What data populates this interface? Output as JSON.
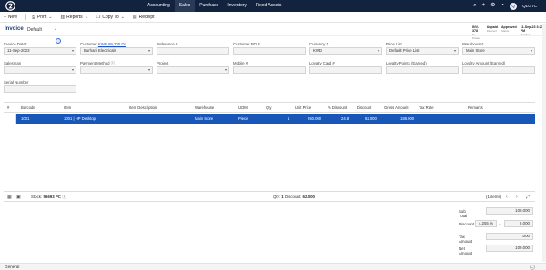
{
  "topbar": {
    "nav": [
      {
        "label": "Accounting",
        "active": false
      },
      {
        "label": "Sales",
        "active": true
      },
      {
        "label": "Purchase",
        "active": false
      },
      {
        "label": "Inventory",
        "active": false
      },
      {
        "label": "Fixed Assets",
        "active": false
      }
    ],
    "avatar_letter": "Q",
    "company": "QLGTC"
  },
  "toolbar": {
    "new_label": "New",
    "print_label": "Print",
    "reports_label": "Reports",
    "copy_to_label": "Copy To",
    "receipt_label": "Receipt"
  },
  "header": {
    "title": "Invoice",
    "layout": "Default"
  },
  "status_steps": [
    {
      "title": "INV-378",
      "sub": "No Posted"
    },
    {
      "title": "Unpaid",
      "sub": "Payment"
    },
    {
      "title": "Approved",
      "sub": "Status"
    },
    {
      "title": "11-Sep-23 3:27 PM",
      "sub": "Modified"
    }
  ],
  "fields": {
    "invoice_date": {
      "label": "Invoice Date*",
      "value": "11-Sep-2023"
    },
    "customer": {
      "label": "Customer",
      "link": "KWD 99,200 Dr",
      "value": "Burhani Electricals"
    },
    "reference": {
      "label": "Reference #",
      "value": ""
    },
    "customer_po": {
      "label": "Customer PO #",
      "value": ""
    },
    "currency": {
      "label": "Currency *",
      "value": "KWD"
    },
    "price_list": {
      "label": "Price List",
      "value": "Default Price List"
    },
    "warehouse": {
      "label": "Warehouse*",
      "value": "Main Store"
    },
    "salesman": {
      "label": "Salesman",
      "value": ""
    },
    "payment_method": {
      "label": "Payment Method",
      "value": ""
    },
    "project": {
      "label": "Project",
      "value": ""
    },
    "mobile": {
      "label": "Mobile #",
      "value": ""
    },
    "loyalty_card": {
      "label": "Loyalty Card #",
      "value": ""
    },
    "loyalty_points": {
      "label": "Loyalty Points (Earned)",
      "value": ""
    },
    "loyalty_amount": {
      "label": "Loyalty Amount (Earned)",
      "value": ""
    },
    "serial_number": {
      "label": "Serial Number",
      "value": ""
    }
  },
  "grid": {
    "columns": [
      "#",
      "Barcode",
      "Item",
      "Item Description",
      "Warehouse",
      "UOM",
      "Qty",
      "Unit Price",
      "% Discount",
      "Discount",
      "Gross Amount",
      "Tax Rate",
      "Remarks"
    ],
    "rows": [
      {
        "barcode": "1001",
        "item": "1001 | HP Desktop",
        "description": "",
        "warehouse": "Main Store",
        "uom": "Piece",
        "qty": "1",
        "unit_price": "250.000",
        "pct_discount": "24.8",
        "discount": "62.000",
        "gross": "188.000",
        "tax_rate": "",
        "remarks": ""
      }
    ]
  },
  "grid_footer": {
    "stock_label": "Stock:",
    "stock_value": "56693 PC",
    "qty_label": "Qty:",
    "qty_value": "1",
    "discount_label": "Discount:",
    "discount_value": "62.000",
    "items_count": "(1 items)"
  },
  "totals": {
    "sub_total_label": "Sub Total",
    "sub_total": "100.000",
    "discount_label": "Discount",
    "discount_pct": "4.255",
    "discount_value": "8.000",
    "tax_label": "Tax Amount",
    "tax_amount": ".000",
    "net_label": "Net Amount",
    "net_amount": "100.000"
  },
  "section": {
    "general_label": "General"
  }
}
